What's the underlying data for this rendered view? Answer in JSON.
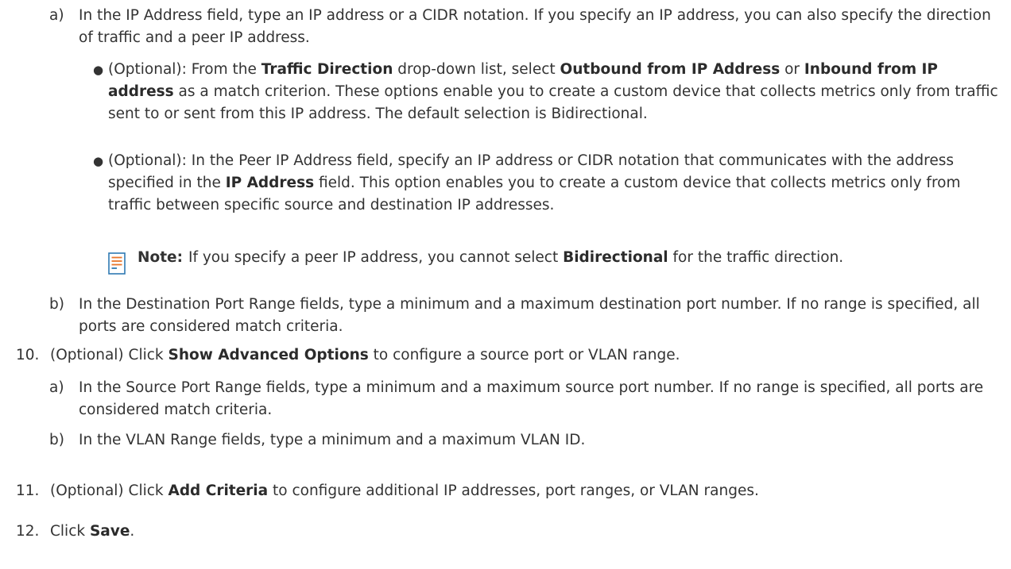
{
  "doc": {
    "step_a": {
      "marker": "a)",
      "text": "In the IP Address field, type an IP address or a CIDR notation. If you specify an IP address, you can also specify the direction of traffic and a peer IP address.",
      "bullets": [
        {
          "parts": [
            {
              "t": "(Optional): From the "
            },
            {
              "t": "Traffic Direction",
              "b": true
            },
            {
              "t": " drop-down list, select "
            },
            {
              "t": "Outbound from IP Address",
              "b": true
            },
            {
              "t": " or "
            },
            {
              "t": "Inbound from IP address",
              "b": true
            },
            {
              "t": " as a match criterion. These options enable you to create a custom device that collects metrics only from traffic sent to or sent from this IP address. The default selection is Bidirectional."
            }
          ]
        },
        {
          "parts": [
            {
              "t": "(Optional): In the Peer IP Address field, specify an IP address or CIDR notation that communicates with the address specified in the "
            },
            {
              "t": "IP Address",
              "b": true
            },
            {
              "t": " field. This option enables you to create a custom device that collects metrics only from traffic between specific source and destination IP addresses."
            }
          ]
        }
      ],
      "note": {
        "label": "Note:",
        "parts": [
          {
            "t": "If you specify a peer IP address, you cannot select "
          },
          {
            "t": "Bidirectional",
            "b": true
          },
          {
            "t": " for the traffic direction."
          }
        ]
      }
    },
    "step_b": {
      "marker": "b)",
      "text": "In the Destination Port Range fields, type a minimum and a maximum destination port number. If no range is specified, all ports are considered match criteria."
    },
    "step_10": {
      "marker": "10.",
      "parts": [
        {
          "t": "(Optional) Click "
        },
        {
          "t": "Show Advanced Options",
          "b": true
        },
        {
          "t": " to configure a source port or VLAN range."
        }
      ],
      "substeps": [
        {
          "marker": "a)",
          "text": "In the Source Port Range fields, type a minimum and a maximum source port number. If no range is specified, all ports are considered match criteria."
        },
        {
          "marker": "b)",
          "text": "In the VLAN Range fields, type a minimum and a maximum VLAN ID."
        }
      ]
    },
    "step_11": {
      "marker": "11.",
      "parts": [
        {
          "t": "(Optional) Click "
        },
        {
          "t": "Add Criteria",
          "b": true
        },
        {
          "t": " to configure additional IP addresses, port ranges, or VLAN ranges."
        }
      ]
    },
    "step_12": {
      "marker": "12.",
      "parts": [
        {
          "t": "Click "
        },
        {
          "t": "Save",
          "b": true
        },
        {
          "t": "."
        }
      ]
    }
  }
}
